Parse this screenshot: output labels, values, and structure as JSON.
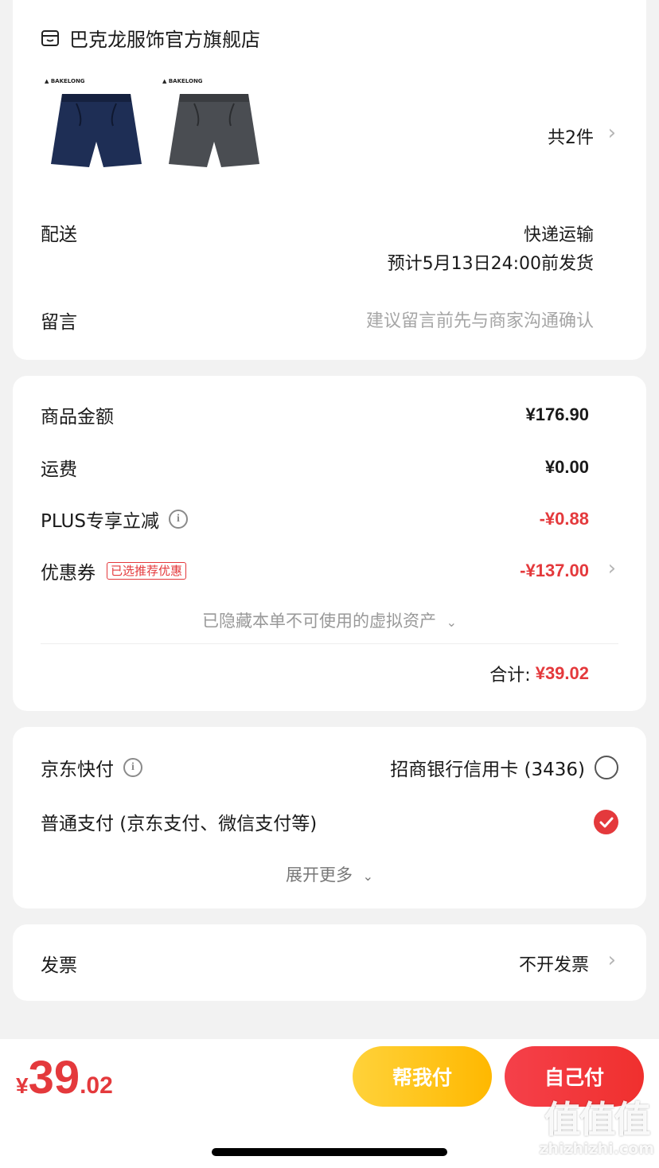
{
  "store": {
    "name": "巴克龙服饰官方旗舰店",
    "icon": "store-icon"
  },
  "products": {
    "count_label": "共2件",
    "items": [
      {
        "name": "navy-shorts",
        "color": "#1e2e55"
      },
      {
        "name": "gray-shorts",
        "color": "#4a4d52"
      }
    ],
    "logo_text": "BAKELONG"
  },
  "delivery": {
    "label": "配送",
    "method": "快递运输",
    "eta": "预计5月13日24:00前发货"
  },
  "message": {
    "label": "留言",
    "placeholder": "建议留言前先与商家沟通确认"
  },
  "price": {
    "goods_label": "商品金额",
    "goods_value": "¥176.90",
    "shipping_label": "运费",
    "shipping_value": "¥0.00",
    "plus_label": "PLUS专享立减",
    "plus_value": "-¥0.88",
    "coupon_label": "优惠券",
    "coupon_badge": "已选推荐优惠",
    "coupon_value": "-¥137.00",
    "hidden_assets": "已隐藏本单不可使用的虚拟资产",
    "total_label": "合计:",
    "total_value": "¥39.02"
  },
  "payment": {
    "quickpay_label": "京东快付",
    "quickpay_card": "招商银行信用卡 (3436)",
    "normal_label": "普通支付 (京东支付、微信支付等)",
    "expand": "展开更多",
    "selected": "normal"
  },
  "invoice": {
    "label": "发票",
    "value": "不开发票"
  },
  "footer": {
    "currency": "¥",
    "amount_int": "39",
    "amount_dec": ".02",
    "help_pay": "帮我付",
    "self_pay": "自己付"
  },
  "watermark": {
    "text": "值值值",
    "url": "zhizhizhi.com"
  },
  "colors": {
    "accent": "#e4393c",
    "help_btn": "#ffc61a",
    "self_btn": "#f23a3c"
  }
}
